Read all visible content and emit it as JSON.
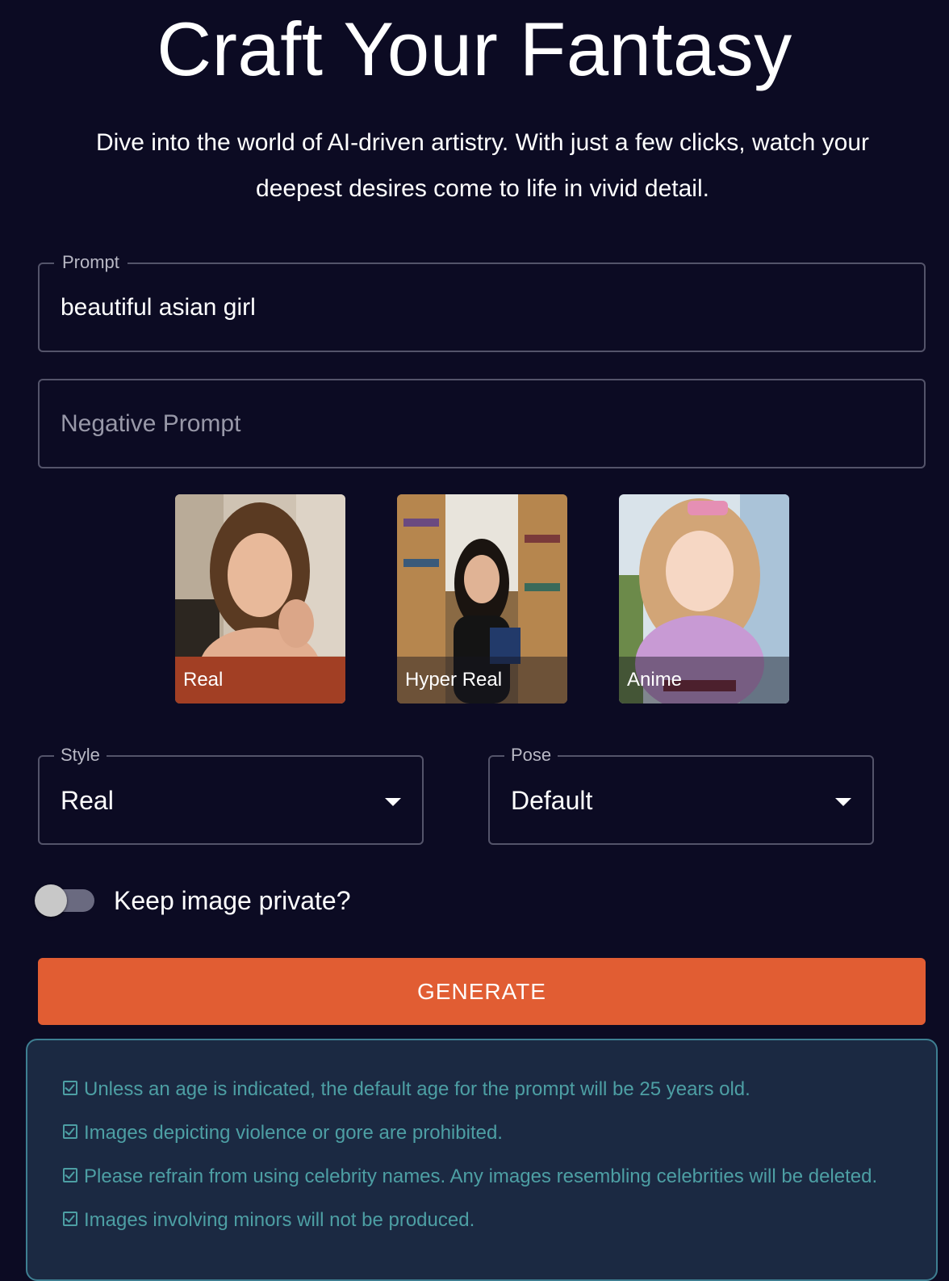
{
  "hero": {
    "title": "Craft Your Fantasy",
    "subtitle_line1": "Dive into the world of AI-driven artistry. With just a few clicks, watch your",
    "subtitle_line2": "deepest desires come to life in vivid detail."
  },
  "prompt": {
    "label": "Prompt",
    "value": "beautiful asian girl"
  },
  "negative_prompt": {
    "placeholder": "Negative Prompt"
  },
  "style_cards": [
    {
      "label": "Real",
      "selected": true
    },
    {
      "label": "Hyper Real",
      "selected": false
    },
    {
      "label": "Anime",
      "selected": false
    }
  ],
  "style_select": {
    "label": "Style",
    "value": "Real"
  },
  "pose_select": {
    "label": "Pose",
    "value": "Default"
  },
  "private_toggle": {
    "label": "Keep image private?",
    "on": false
  },
  "generate_label": "GENERATE",
  "notices": [
    "Unless an age is indicated, the default age for the prompt will be 25 years old.",
    "Images depicting violence or gore are prohibited.",
    "Please refrain from using celebrity names. Any images resembling celebrities will be deleted.",
    "Images involving minors will not be produced."
  ],
  "colors": {
    "background": "#0c0b23",
    "accent": "#e15d33",
    "selected_caption": "#a23f24",
    "notice_bg": "#1b2942",
    "notice_text": "#4d9fa4"
  }
}
